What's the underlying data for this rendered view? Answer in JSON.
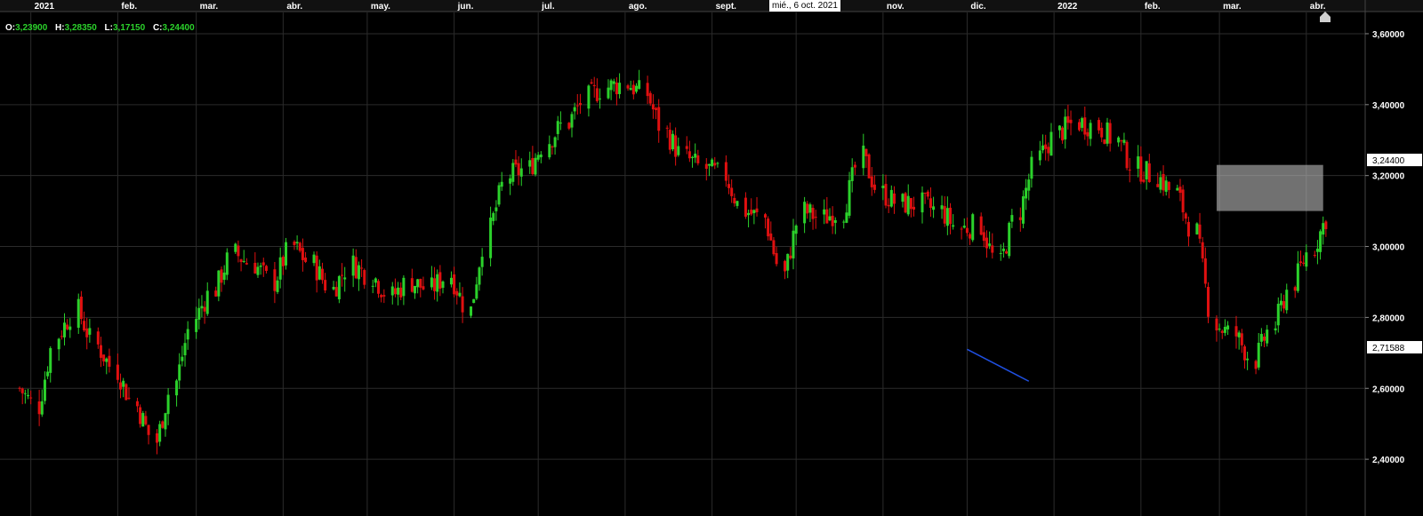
{
  "ohlc": {
    "open_label": "O:",
    "open": "3,23900",
    "high_label": "H:",
    "high": "3,28350",
    "low_label": "L:",
    "low": "3,17150",
    "close_label": "C:",
    "close": "3,24400"
  },
  "crosshair_date": "mié., 6 oct. 2021",
  "colors": {
    "background": "#000000",
    "grid": "#2b2b2b",
    "up": "#2bd12b",
    "down": "#e01010",
    "trendline": "#1f4fe0",
    "zone": "#bdbdbd"
  },
  "chart_data": {
    "type": "candlestick",
    "x_ticks": [
      "2021",
      "feb.",
      "mar.",
      "abr.",
      "may.",
      "jun.",
      "jul.",
      "ago.",
      "sept.",
      "oct.",
      "nov.",
      "dic.",
      "2022",
      "feb.",
      "mar.",
      "abr."
    ],
    "y_ticks": [
      "3,60000",
      "3,40000",
      "3,20000",
      "3,00000",
      "2,80000",
      "2,60000",
      "2,40000"
    ],
    "ylim": [
      2.24,
      3.66
    ],
    "price_markers": [
      {
        "label": "3,24400",
        "value": 3.244
      },
      {
        "label": "2,71588",
        "value": 2.71588
      }
    ],
    "grid": true,
    "trendline": {
      "from": {
        "date": "2021-12-01",
        "value": 2.71
      },
      "to": {
        "date": "2021-12-23",
        "value": 2.62
      }
    },
    "zone": {
      "from_date": "2022-02-28",
      "to_date": "2022-04-07",
      "low": 3.1,
      "high": 3.23
    },
    "closes_weekly": [
      2.6,
      2.55,
      2.75,
      2.82,
      2.72,
      2.65,
      2.55,
      2.45,
      2.62,
      2.8,
      2.88,
      2.98,
      2.95,
      2.9,
      3.0,
      2.95,
      2.88,
      2.95,
      2.92,
      2.86,
      2.9,
      2.88,
      2.92,
      2.82,
      3.05,
      3.2,
      3.22,
      3.3,
      3.35,
      3.42,
      3.45,
      3.46,
      3.43,
      3.32,
      3.25,
      3.22,
      3.2,
      3.1,
      3.08,
      2.92,
      3.1,
      3.08,
      3.1,
      3.25,
      3.15,
      3.12,
      3.12,
      3.1,
      3.05,
      3.06,
      2.95,
      3.1,
      3.25,
      3.32,
      3.35,
      3.34,
      3.3,
      3.22,
      3.2,
      3.15,
      3.04,
      2.78,
      2.75,
      2.68,
      2.78,
      2.9,
      3.0,
      3.1,
      3.15,
      3.1,
      2.95,
      3.15,
      3.32,
      3.45,
      3.3,
      3.15,
      2.85,
      2.65,
      2.85,
      3.1,
      3.15,
      3.18,
      3.2
    ]
  }
}
